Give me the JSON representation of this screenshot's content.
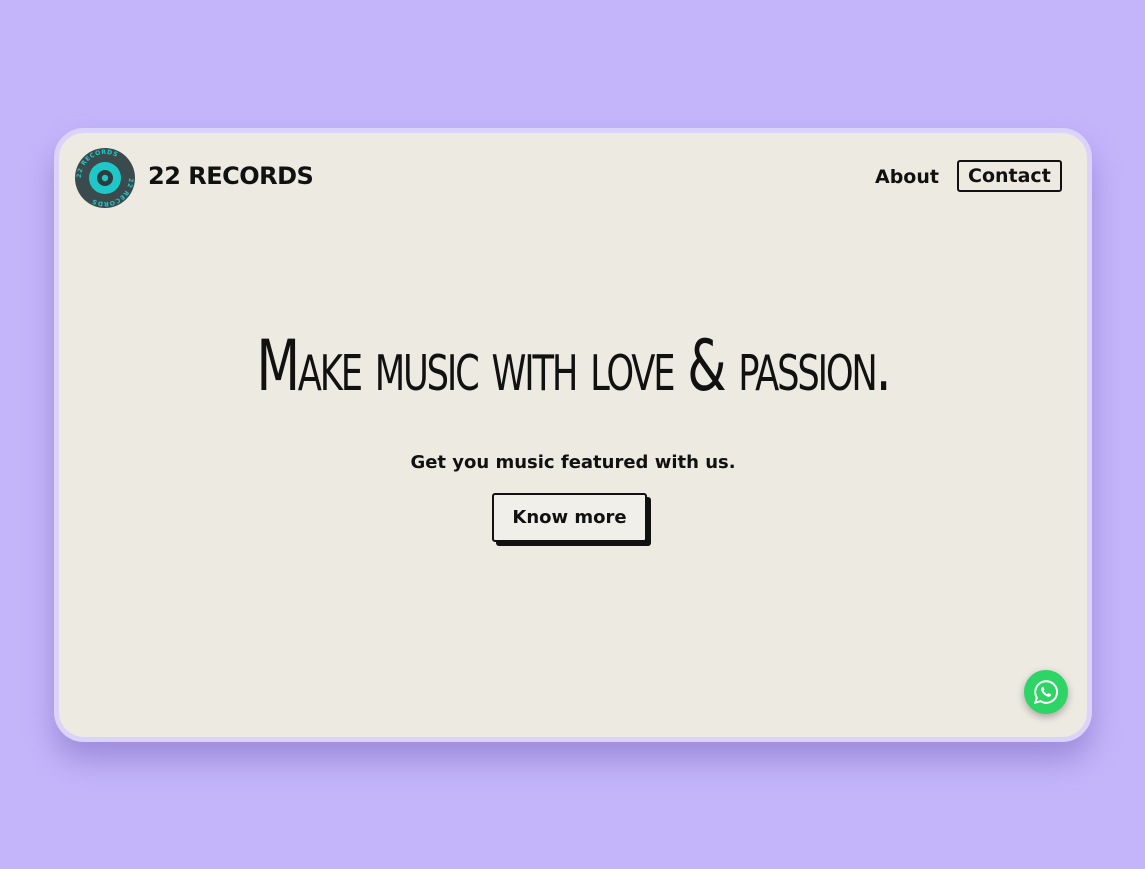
{
  "brand": {
    "name": "22 RECORDS",
    "logo_ring_text": "22 RECORDS",
    "logo_icon": "vinyl-record-logo"
  },
  "nav": {
    "items": [
      {
        "label": "About"
      },
      {
        "label": "Contact"
      }
    ]
  },
  "hero": {
    "title": "Make music with love & passion.",
    "subtitle": "Get you music featured with us.",
    "cta_label": "Know more"
  },
  "floating": {
    "icon": "whatsapp-icon"
  },
  "colors": {
    "page_background": "#c4b5fb",
    "card_background": "#edeae2",
    "card_border": "#dcd3fb",
    "text": "#111111",
    "logo_dark": "#3b4a4d",
    "logo_accent": "#1fc8c8",
    "whatsapp": "#2fd467"
  }
}
